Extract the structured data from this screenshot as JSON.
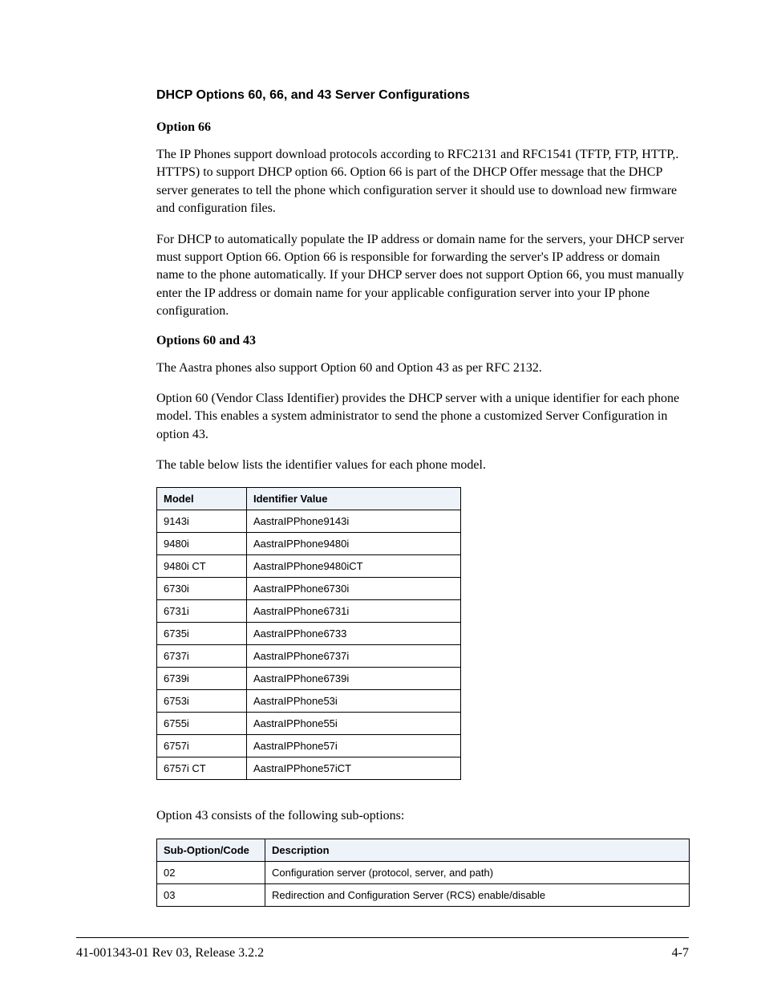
{
  "section_title": "DHCP Options 60, 66, and 43 Server Configurations",
  "option66": {
    "heading": "Option 66",
    "p1": "The IP Phones support download protocols according to RFC2131 and RFC1541 (TFTP, FTP, HTTP,. HTTPS) to support DHCP option 66. Option 66 is part of the DHCP Offer message that the DHCP server generates to tell the phone which configuration server it should use to download new firmware and configuration files.",
    "p2": "For DHCP to automatically populate the IP address or domain name for the servers, your DHCP server must support Option 66. Option 66 is responsible for forwarding the server's IP address or domain name to the phone automatically. If your DHCP server does not support Option 66, you must manually enter the IP address or domain name for your applicable configuration server into your IP phone configuration."
  },
  "options6043": {
    "heading": "Options 60 and 43",
    "p1": "The Aastra phones also support Option 60 and Option 43 as per RFC 2132.",
    "p2": "Option 60 (Vendor Class Identifier) provides the DHCP server with a unique identifier for each phone model.  This enables a system administrator to send the phone a customized Server Configuration in option 43.",
    "p3": "The table below lists the identifier values for each phone model."
  },
  "table1": {
    "h1": "Model",
    "h2": "Identifier Value",
    "rows": [
      {
        "m": "9143i",
        "v": "AastraIPPhone9143i"
      },
      {
        "m": "9480i",
        "v": "AastraIPPhone9480i"
      },
      {
        "m": "9480i CT",
        "v": "AastraIPPhone9480iCT"
      },
      {
        "m": "6730i",
        "v": "AastraIPPhone6730i"
      },
      {
        "m": "6731i",
        "v": "AastraIPPhone6731i"
      },
      {
        "m": "6735i",
        "v": "AastraIPPhone6733"
      },
      {
        "m": "6737i",
        "v": "AastraIPPhone6737i"
      },
      {
        "m": "6739i",
        "v": "AastraIPPhone6739i"
      },
      {
        "m": "6753i",
        "v": "AastraIPPhone53i"
      },
      {
        "m": "6755i",
        "v": "AastraIPPhone55i"
      },
      {
        "m": "6757i",
        "v": "AastraIPPhone57i"
      },
      {
        "m": "6757i CT",
        "v": "AastraIPPhone57iCT"
      }
    ]
  },
  "option43_intro": "Option 43 consists of the following sub-options:",
  "table2": {
    "h1": "Sub-Option/Code",
    "h2": "Description",
    "rows": [
      {
        "c": "02",
        "d": "Configuration server (protocol, server, and path)"
      },
      {
        "c": "03",
        "d": "Redirection and Configuration Server (RCS) enable/disable"
      }
    ]
  },
  "footer": {
    "left": "41-001343-01 Rev 03, Release 3.2.2",
    "right": "4-7"
  }
}
